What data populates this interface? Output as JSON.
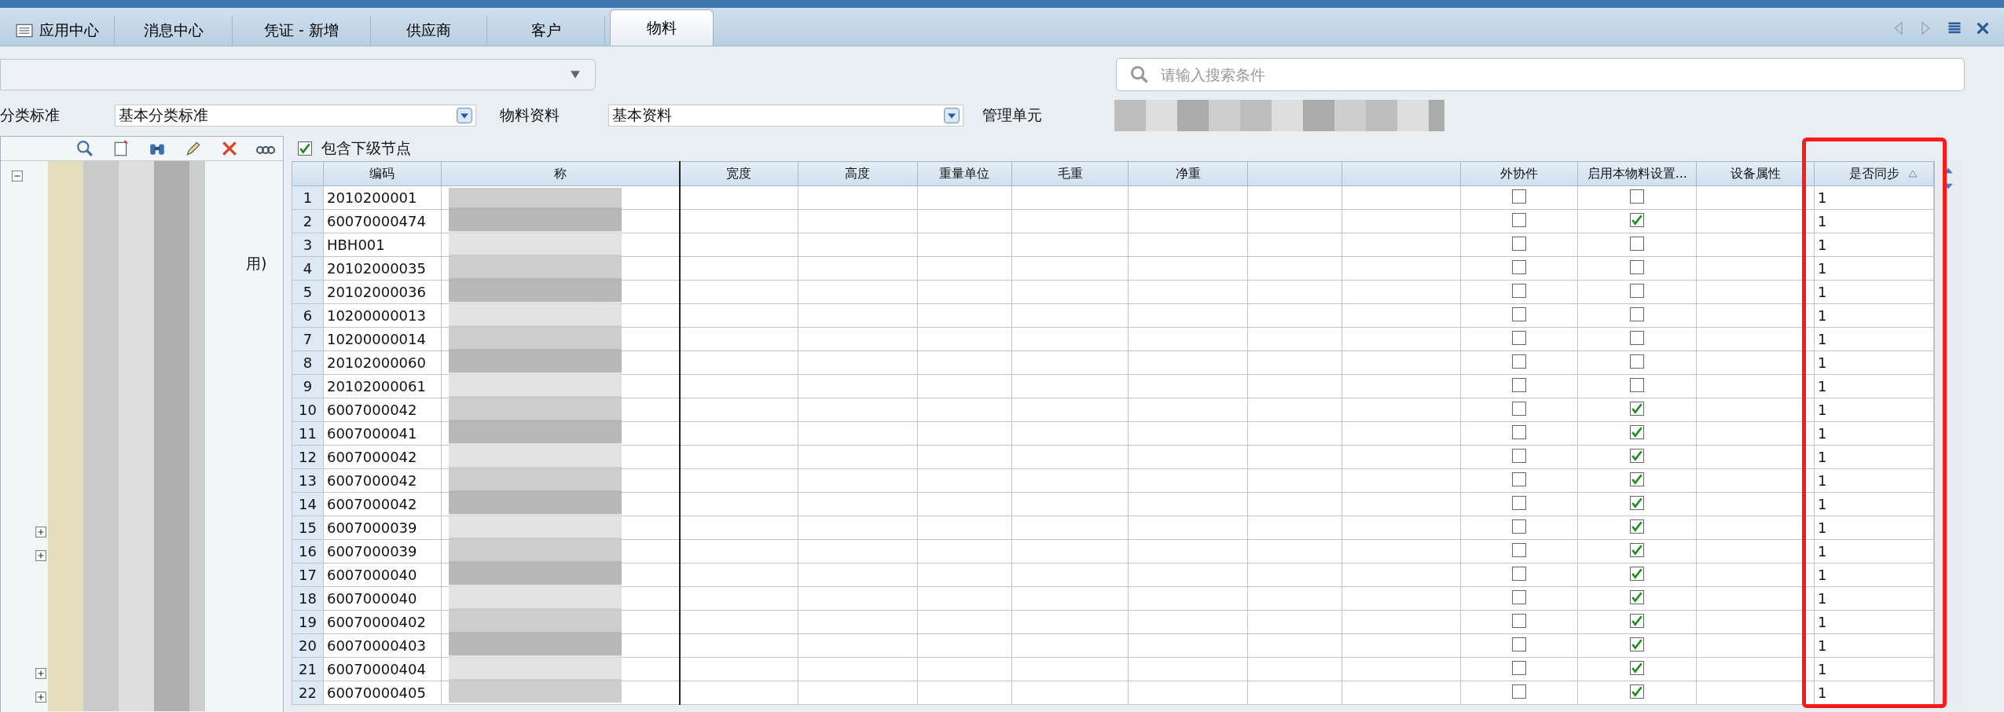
{
  "tabs": [
    {
      "label": "应用中心",
      "selected": false,
      "icon": true
    },
    {
      "label": "消息中心",
      "selected": false
    },
    {
      "label": "凭证 - 新增",
      "selected": false
    },
    {
      "label": "供应商",
      "selected": false
    },
    {
      "label": "客户",
      "selected": false
    },
    {
      "label": "物料",
      "selected": true
    }
  ],
  "search": {
    "placeholder": "请输入搜索条件"
  },
  "filters": [
    {
      "label": "分类标准",
      "value": "基本分类标准"
    },
    {
      "label": "物料资料",
      "value": "基本资料"
    }
  ],
  "management_unit": {
    "label": "管理单元"
  },
  "tree": {
    "fragment": "用)"
  },
  "include_children": {
    "label": "包含下级节点",
    "checked": true
  },
  "table": {
    "columns": [
      {
        "label": "编码",
        "sorted": false
      },
      {
        "label": "称",
        "sorted": false
      },
      {
        "label": "宽度",
        "sorted": false
      },
      {
        "label": "高度",
        "sorted": false
      },
      {
        "label": "重量单位",
        "sorted": false
      },
      {
        "label": "毛重",
        "sorted": false
      },
      {
        "label": "净重",
        "sorted": false
      },
      {
        "sorted": false
      },
      {
        "sorted": false
      },
      {
        "label": "外协件",
        "sorted": false
      },
      {
        "label": "启用本物料设置...",
        "sorted": false
      },
      {
        "label": "设备属性",
        "sorted": false
      },
      {
        "label": "是否同步",
        "sorted": true
      }
    ],
    "rows": [
      {
        "num": "1",
        "code": "2010200001",
        "outsourced": false,
        "enabled": false,
        "sync": "1"
      },
      {
        "num": "2",
        "code": "60070000474",
        "outsourced": false,
        "enabled": true,
        "sync": "1"
      },
      {
        "num": "3",
        "code": "HBH001",
        "outsourced": false,
        "enabled": false,
        "sync": "1"
      },
      {
        "num": "4",
        "code": "20102000035",
        "outsourced": false,
        "enabled": false,
        "sync": "1"
      },
      {
        "num": "5",
        "code": "20102000036",
        "outsourced": false,
        "enabled": false,
        "sync": "1"
      },
      {
        "num": "6",
        "code": "10200000013",
        "outsourced": false,
        "enabled": false,
        "sync": "1"
      },
      {
        "num": "7",
        "code": "10200000014",
        "outsourced": false,
        "enabled": false,
        "sync": "1"
      },
      {
        "num": "8",
        "code": "20102000060",
        "outsourced": false,
        "enabled": false,
        "sync": "1"
      },
      {
        "num": "9",
        "code": "20102000061",
        "outsourced": false,
        "enabled": false,
        "sync": "1"
      },
      {
        "num": "10",
        "code": "6007000042",
        "outsourced": false,
        "enabled": true,
        "sync": "1"
      },
      {
        "num": "11",
        "code": "6007000041",
        "outsourced": false,
        "enabled": true,
        "sync": "1"
      },
      {
        "num": "12",
        "code": "6007000042",
        "outsourced": false,
        "enabled": true,
        "sync": "1"
      },
      {
        "num": "13",
        "code": "6007000042",
        "outsourced": false,
        "enabled": true,
        "sync": "1"
      },
      {
        "num": "14",
        "code": "6007000042",
        "outsourced": false,
        "enabled": true,
        "sync": "1"
      },
      {
        "num": "15",
        "code": "6007000039",
        "outsourced": false,
        "enabled": true,
        "sync": "1"
      },
      {
        "num": "16",
        "code": "6007000039",
        "outsourced": false,
        "enabled": true,
        "sync": "1"
      },
      {
        "num": "17",
        "code": "6007000040",
        "outsourced": false,
        "enabled": true,
        "sync": "1"
      },
      {
        "num": "18",
        "code": "6007000040",
        "outsourced": false,
        "enabled": true,
        "sync": "1"
      },
      {
        "num": "19",
        "code": "60070000402",
        "outsourced": false,
        "enabled": true,
        "sync": "1"
      },
      {
        "num": "20",
        "code": "60070000403",
        "outsourced": false,
        "enabled": true,
        "sync": "1"
      },
      {
        "num": "21",
        "code": "60070000404",
        "outsourced": false,
        "enabled": true,
        "sync": "1"
      },
      {
        "num": "22",
        "code": "60070000405",
        "outsourced": false,
        "enabled": true,
        "sync": "1"
      }
    ]
  }
}
